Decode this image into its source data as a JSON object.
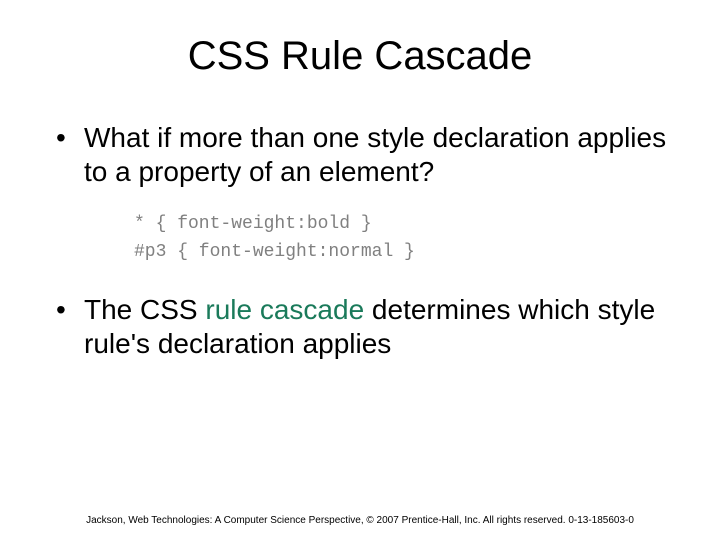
{
  "title": "CSS Rule Cascade",
  "bullets": {
    "b1": "What if more than one style declaration applies to a property of an element?",
    "b2_pre": "The CSS ",
    "b2_em": "rule cascade",
    "b2_post": " determines which style rule's declaration applies"
  },
  "code": {
    "line1": "* { font-weight:bold }",
    "line2": "#p3 { font-weight:normal }"
  },
  "footer": "Jackson, Web Technologies: A Computer Science Perspective, © 2007 Prentice-Hall, Inc. All rights reserved. 0-13-185603-0"
}
